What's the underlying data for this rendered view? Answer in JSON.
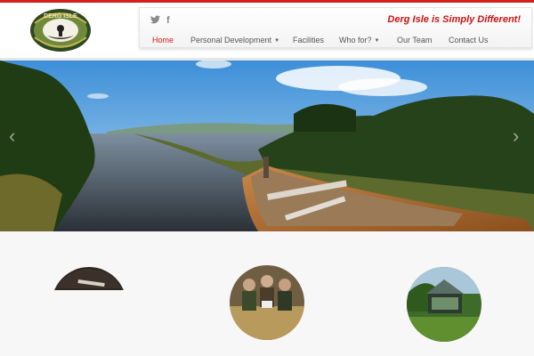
{
  "site": {
    "logo_text": "DERG ISLE",
    "tagline": "Derg Isle is Simply Different!"
  },
  "social": {
    "twitter_glyph": "🐦",
    "facebook_glyph": "f"
  },
  "nav": {
    "items": [
      {
        "label": "Home",
        "active": true
      },
      {
        "label": "Personal Development",
        "dropdown": true
      },
      {
        "label": "Facilities"
      },
      {
        "label": "Who for?",
        "dropdown": true
      },
      {
        "label": "Our Team"
      },
      {
        "label": "Contact Us"
      }
    ],
    "dropdown_caret": "▼"
  },
  "slider": {
    "prev": "‹",
    "next": "›"
  },
  "icons": [
    "twitter-icon",
    "facebook-icon",
    "chevron-down-icon",
    "chevron-left-icon",
    "chevron-right-icon"
  ],
  "colors": {
    "accent": "#d21b1b",
    "nav_text": "#555555",
    "background": "#f7f7f7"
  }
}
